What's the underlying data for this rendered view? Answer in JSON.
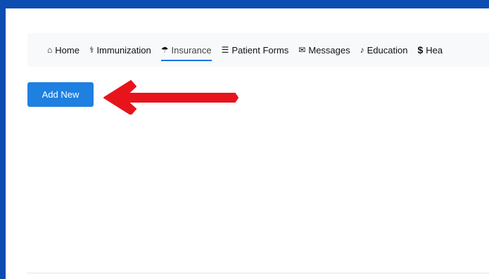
{
  "nav": {
    "items": [
      {
        "label": "Home",
        "icon": "home-icon",
        "glyph": "⌂",
        "active": false
      },
      {
        "label": "Immunization",
        "icon": "stethoscope-icon",
        "glyph": "⚕",
        "active": false
      },
      {
        "label": "Insurance",
        "icon": "umbrella-icon",
        "glyph": "☂",
        "active": true
      },
      {
        "label": "Patient Forms",
        "icon": "list-icon",
        "glyph": "☰",
        "active": false
      },
      {
        "label": "Messages",
        "icon": "envelope-icon",
        "glyph": "✉",
        "active": false
      },
      {
        "label": "Education",
        "icon": "bell-icon",
        "glyph": "♪",
        "active": false
      },
      {
        "label": "Hea",
        "icon": "dollar-icon",
        "glyph": "$",
        "active": false
      }
    ]
  },
  "toolbar": {
    "add_label": "Add New"
  },
  "colors": {
    "background": "#0b4db0",
    "accent": "#1e80e0",
    "active_underline": "#1a73e8",
    "arrow": "#e8141c"
  }
}
